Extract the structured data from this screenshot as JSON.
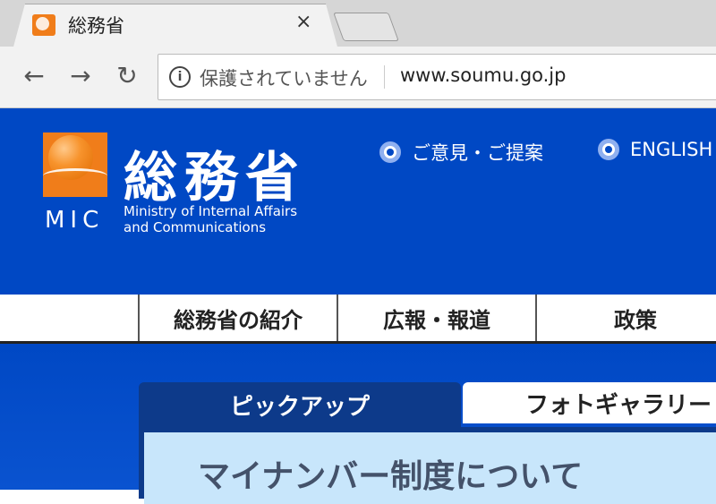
{
  "browser": {
    "tab_title": "総務省",
    "close_label": "×",
    "back_label": "←",
    "forward_label": "→",
    "reload_label": "↻",
    "info_label": "i",
    "security_text": "保護されていません",
    "url": "www.soumu.go.jp"
  },
  "header": {
    "logo_kanji": "総務省",
    "logo_abbr": "MIC",
    "logo_en_line1": "Ministry of Internal Affairs",
    "logo_en_line2": "and Communications",
    "link_opinion": "ご意見・ご提案",
    "link_english": "ENGLISH"
  },
  "nav": {
    "items": [
      "総務省の紹介",
      "広報・報道",
      "政策"
    ]
  },
  "main": {
    "tab_pickup": "ピックアップ",
    "tab_photo": "フォトギャラリー",
    "headline": "マイナンバー制度について"
  },
  "colors": {
    "brand_blue": "#0048c4",
    "logo_orange": "#f07d1a",
    "tab_navy": "#0d3a8a",
    "panel_light_blue": "#c8e6fb"
  }
}
